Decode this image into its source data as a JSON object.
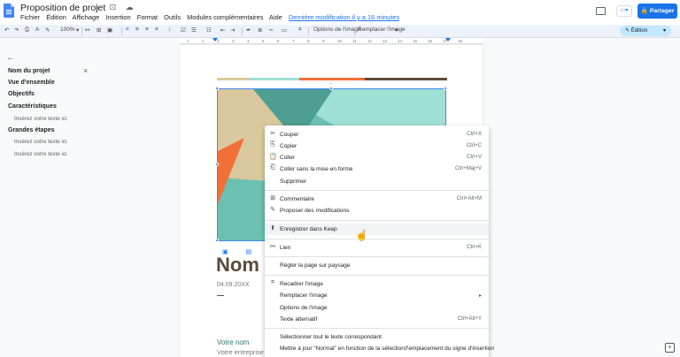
{
  "app": {
    "doc_title": "Proposition de projet",
    "title_icons": "☆ ⊡ ☁",
    "menu": [
      "Fichier",
      "Édition",
      "Affichage",
      "Insertion",
      "Format",
      "Outils",
      "Modules complémentaires",
      "Aide"
    ],
    "last_edit": "Dernière modification il y a 16 minutes",
    "share_label": "Partager",
    "meet_label": "▭▾"
  },
  "toolbar": {
    "undo": "↶",
    "redo": "↷",
    "print": "⎙",
    "spell": "A",
    "paint": "✎",
    "zoom": "100%",
    "link": "⚯",
    "comment": "⊞",
    "image": "▣",
    "align_left": "≡",
    "align_center": "≡",
    "align_right": "≡",
    "justify": "≡",
    "line_spacing": "↕",
    "checklist": "☑",
    "bullets": "☰",
    "numbered": "☷",
    "indent_less": "⇤",
    "indent_more": "⇥",
    "pen": "✒",
    "border_w": "≣",
    "border_dash": "┅",
    "border_col": "▭",
    "crop": "⌗",
    "image_options": "Options de l'image",
    "replace_image": "Remplacer l'image",
    "mode": "✎ Édition"
  },
  "ruler": [
    "1",
    "1",
    "2",
    "3",
    "4",
    "5",
    "6",
    "7",
    "8",
    "9",
    "10",
    "11",
    "12",
    "13",
    "14",
    "15",
    "16",
    "17",
    "18"
  ],
  "outline": {
    "back": "←",
    "close": "×",
    "items": [
      {
        "label": "Nom du projet",
        "level": 1
      },
      {
        "label": "Vue d'ensemble",
        "level": 1
      },
      {
        "label": "Objectifs",
        "level": 1
      },
      {
        "label": "Caractéristiques",
        "level": 1
      },
      {
        "label": "Insérez votre texte ici",
        "level": 2
      },
      {
        "label": "Grandes étapes",
        "level": 1
      },
      {
        "label": "Insérez votre texte ici",
        "level": 2
      },
      {
        "label": "Insérez votre texte ici",
        "level": 2
      }
    ]
  },
  "document": {
    "title_fragment": "Nom du projet",
    "date": "04.09.20XX",
    "name": "Votre nom",
    "company": "Votre entreprise",
    "image_tools": "▣ ▤ ▥ ▦",
    "colors": {
      "sand": "#d9c89e",
      "teal_light": "#9fe0d5",
      "orange": "#f26f3a",
      "brown": "#5c4d3c",
      "teal": "#6cc0b2",
      "title_brown": "#5a4b3a"
    }
  },
  "context_menu": {
    "items": [
      {
        "icon": "✂",
        "label": "Couper",
        "shortcut": "Ctrl+X"
      },
      {
        "icon": "⎘",
        "label": "Copier",
        "shortcut": "Ctrl+C"
      },
      {
        "icon": "📋",
        "label": "Coller",
        "shortcut": "Ctrl+V"
      },
      {
        "icon": "⎗",
        "label": "Coller sans la mise en forme",
        "shortcut": "Ctrl+Maj+V"
      },
      {
        "icon": "",
        "label": "Supprimer",
        "shortcut": ""
      },
      {
        "icon": "⊞",
        "label": "Commentaire",
        "shortcut": "Ctrl+Alt+M"
      },
      {
        "icon": "✎",
        "label": "Proposer des modifications",
        "shortcut": ""
      },
      {
        "icon": "⬆",
        "label": "Enregistrer dans Keep",
        "shortcut": ""
      },
      {
        "icon": "⚯",
        "label": "Lien",
        "shortcut": "Ctrl+K"
      },
      {
        "icon": "",
        "label": "Régler la page sur paysage",
        "shortcut": ""
      },
      {
        "icon": "⌗",
        "label": "Recadrer l'image",
        "shortcut": ""
      },
      {
        "icon": "",
        "label": "Remplacer l'image",
        "shortcut": "▸"
      },
      {
        "icon": "",
        "label": "Options de l'image",
        "shortcut": ""
      },
      {
        "icon": "",
        "label": "Texte alternatif",
        "shortcut": "Ctrl+Alt+Y"
      },
      {
        "icon": "",
        "label": "Sélectionner tout le texte correspondant",
        "shortcut": ""
      },
      {
        "icon": "",
        "label": "Mettre à jour \"Normal\" en fonction de la sélection/l'emplacement du signe d'insertion",
        "shortcut": ""
      }
    ],
    "cursor": "☝"
  },
  "explore_button": "+"
}
